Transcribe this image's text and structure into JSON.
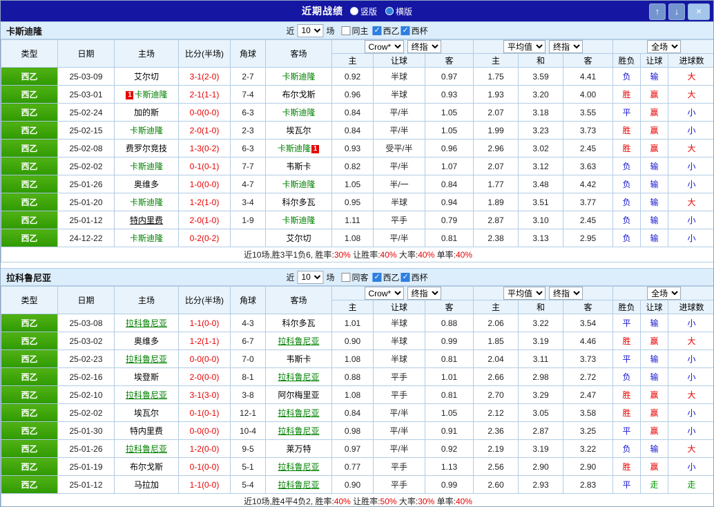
{
  "titlebar": {
    "title": "近期战绩",
    "radios": [
      {
        "label": "竖版",
        "selected": false
      },
      {
        "label": "横版",
        "selected": true
      }
    ],
    "up_icon": "↑",
    "down_icon": "↓",
    "close_icon": "×"
  },
  "labels": {
    "near": "近",
    "games": "场"
  },
  "header": {
    "cols": [
      "类型",
      "日期",
      "主场",
      "比分(半场)",
      "角球",
      "客场"
    ],
    "group1": {
      "select1": "Crow*",
      "select2": "终指",
      "subs": [
        "主",
        "让球",
        "客"
      ]
    },
    "group2": {
      "select1": "平均值",
      "select2": "终指",
      "subs": [
        "主",
        "和",
        "客"
      ]
    },
    "group3": {
      "select": "全场",
      "subs": [
        "胜负",
        "让球",
        "进球数"
      ]
    }
  },
  "sections": [
    {
      "team": "卡斯迪隆",
      "near_count": "10",
      "checks": [
        {
          "label": "同主",
          "checked": false
        },
        {
          "label": "西乙",
          "checked": true
        },
        {
          "label": "西杯",
          "checked": true
        }
      ],
      "rows": [
        {
          "lg": "西乙",
          "dt": "25-03-09",
          "h": {
            "n": "艾尔切"
          },
          "sc": "3-1(2-0)",
          "cn": "2-7",
          "a": {
            "n": "卡斯迪隆",
            "g": 1
          },
          "od": [
            "0.92",
            "半球",
            "0.97"
          ],
          "av": [
            "1.75",
            "3.59",
            "4.41"
          ],
          "rs": [
            [
              "负",
              "b"
            ],
            [
              "输",
              "b"
            ],
            [
              "大",
              "r"
            ]
          ]
        },
        {
          "lg": "西乙",
          "dt": "25-03-01",
          "h": {
            "n": "卡斯迪隆",
            "g": 1,
            "b1": "1"
          },
          "sc": "2-1(1-1)",
          "cn": "7-4",
          "a": {
            "n": "布尔戈斯"
          },
          "od": [
            "0.96",
            "半球",
            "0.93"
          ],
          "av": [
            "1.93",
            "3.20",
            "4.00"
          ],
          "rs": [
            [
              "胜",
              "r"
            ],
            [
              "赢",
              "r"
            ],
            [
              "大",
              "r"
            ]
          ]
        },
        {
          "lg": "西乙",
          "dt": "25-02-24",
          "h": {
            "n": "加的斯"
          },
          "sc": "0-0(0-0)",
          "cn": "6-3",
          "a": {
            "n": "卡斯迪隆",
            "g": 1
          },
          "od": [
            "0.84",
            "平/半",
            "1.05"
          ],
          "av": [
            "2.07",
            "3.18",
            "3.55"
          ],
          "rs": [
            [
              "平",
              "b"
            ],
            [
              "赢",
              "r"
            ],
            [
              "小",
              "b"
            ]
          ]
        },
        {
          "lg": "西乙",
          "dt": "25-02-15",
          "h": {
            "n": "卡斯迪隆",
            "g": 1
          },
          "sc": "2-0(1-0)",
          "cn": "2-3",
          "a": {
            "n": "埃瓦尔"
          },
          "od": [
            "0.84",
            "平/半",
            "1.05"
          ],
          "av": [
            "1.99",
            "3.23",
            "3.73"
          ],
          "rs": [
            [
              "胜",
              "r"
            ],
            [
              "赢",
              "r"
            ],
            [
              "小",
              "b"
            ]
          ]
        },
        {
          "lg": "西乙",
          "dt": "25-02-08",
          "h": {
            "n": "费罗尔竞技"
          },
          "sc": "1-3(0-2)",
          "cn": "6-3",
          "a": {
            "n": "卡斯迪隆",
            "g": 1,
            "b2": "1"
          },
          "od": [
            "0.93",
            "受平/半",
            "0.96"
          ],
          "av": [
            "2.96",
            "3.02",
            "2.45"
          ],
          "rs": [
            [
              "胜",
              "r"
            ],
            [
              "赢",
              "r"
            ],
            [
              "大",
              "r"
            ]
          ]
        },
        {
          "lg": "西乙",
          "dt": "25-02-02",
          "h": {
            "n": "卡斯迪隆",
            "g": 1
          },
          "sc": "0-1(0-1)",
          "cn": "7-7",
          "a": {
            "n": "韦斯卡"
          },
          "od": [
            "0.82",
            "平/半",
            "1.07"
          ],
          "av": [
            "2.07",
            "3.12",
            "3.63"
          ],
          "rs": [
            [
              "负",
              "b"
            ],
            [
              "输",
              "b"
            ],
            [
              "小",
              "b"
            ]
          ]
        },
        {
          "lg": "西乙",
          "dt": "25-01-26",
          "h": {
            "n": "奥维多"
          },
          "sc": "1-0(0-0)",
          "cn": "4-7",
          "a": {
            "n": "卡斯迪隆",
            "g": 1
          },
          "od": [
            "1.05",
            "半/一",
            "0.84"
          ],
          "av": [
            "1.77",
            "3.48",
            "4.42"
          ],
          "rs": [
            [
              "负",
              "b"
            ],
            [
              "输",
              "b"
            ],
            [
              "小",
              "b"
            ]
          ]
        },
        {
          "lg": "西乙",
          "dt": "25-01-20",
          "h": {
            "n": "卡斯迪隆",
            "g": 1
          },
          "sc": "1-2(1-0)",
          "cn": "3-4",
          "a": {
            "n": "科尔多瓦"
          },
          "od": [
            "0.95",
            "半球",
            "0.94"
          ],
          "av": [
            "1.89",
            "3.51",
            "3.77"
          ],
          "rs": [
            [
              "负",
              "b"
            ],
            [
              "输",
              "b"
            ],
            [
              "大",
              "r"
            ]
          ]
        },
        {
          "lg": "西乙",
          "dt": "25-01-12",
          "h": {
            "n": "特内里费",
            "u": 1
          },
          "sc": "2-0(1-0)",
          "cn": "1-9",
          "a": {
            "n": "卡斯迪隆",
            "g": 1
          },
          "od": [
            "1.11",
            "平手",
            "0.79"
          ],
          "av": [
            "2.87",
            "3.10",
            "2.45"
          ],
          "rs": [
            [
              "负",
              "b"
            ],
            [
              "输",
              "b"
            ],
            [
              "小",
              "b"
            ]
          ]
        },
        {
          "lg": "西乙",
          "dt": "24-12-22",
          "h": {
            "n": "卡斯迪隆",
            "g": 1
          },
          "sc": "0-2(0-2)",
          "cn": "",
          "a": {
            "n": "艾尔切"
          },
          "od": [
            "1.08",
            "平/半",
            "0.81"
          ],
          "av": [
            "2.38",
            "3.13",
            "2.95"
          ],
          "rs": [
            [
              "负",
              "b"
            ],
            [
              "输",
              "b"
            ],
            [
              "小",
              "b"
            ]
          ]
        }
      ],
      "summary": [
        {
          "t": "近10场,胜3平1负6, ",
          "c": "k"
        },
        {
          "t": "胜率:",
          "c": "k"
        },
        {
          "t": "30%",
          "c": "r"
        },
        {
          "t": " 让胜率:",
          "c": "k"
        },
        {
          "t": "40%",
          "c": "r"
        },
        {
          "t": " 大率:",
          "c": "k"
        },
        {
          "t": "40%",
          "c": "r"
        },
        {
          "t": " 单率:",
          "c": "k"
        },
        {
          "t": "40%",
          "c": "r"
        }
      ]
    },
    {
      "team": "拉科鲁尼亚",
      "near_count": "10",
      "checks": [
        {
          "label": "同客",
          "checked": false
        },
        {
          "label": "西乙",
          "checked": true
        },
        {
          "label": "西杯",
          "checked": true
        }
      ],
      "rows": [
        {
          "lg": "西乙",
          "dt": "25-03-08",
          "h": {
            "n": "拉科鲁尼亚",
            "g": 1,
            "u": 1
          },
          "sc": "1-1(0-0)",
          "cn": "4-3",
          "a": {
            "n": "科尔多瓦"
          },
          "od": [
            "1.01",
            "半球",
            "0.88"
          ],
          "av": [
            "2.06",
            "3.22",
            "3.54"
          ],
          "rs": [
            [
              "平",
              "b"
            ],
            [
              "输",
              "b"
            ],
            [
              "小",
              "b"
            ]
          ]
        },
        {
          "lg": "西乙",
          "dt": "25-03-02",
          "h": {
            "n": "奥维多"
          },
          "sc": "1-2(1-1)",
          "cn": "6-7",
          "a": {
            "n": "拉科鲁尼亚",
            "g": 1,
            "u": 1
          },
          "od": [
            "0.90",
            "半球",
            "0.99"
          ],
          "av": [
            "1.85",
            "3.19",
            "4.46"
          ],
          "rs": [
            [
              "胜",
              "r"
            ],
            [
              "赢",
              "r"
            ],
            [
              "大",
              "r"
            ]
          ]
        },
        {
          "lg": "西乙",
          "dt": "25-02-23",
          "h": {
            "n": "拉科鲁尼亚",
            "g": 1,
            "u": 1
          },
          "sc": "0-0(0-0)",
          "cn": "7-0",
          "a": {
            "n": "韦斯卡"
          },
          "od": [
            "1.08",
            "半球",
            "0.81"
          ],
          "av": [
            "2.04",
            "3.11",
            "3.73"
          ],
          "rs": [
            [
              "平",
              "b"
            ],
            [
              "输",
              "b"
            ],
            [
              "小",
              "b"
            ]
          ]
        },
        {
          "lg": "西乙",
          "dt": "25-02-16",
          "h": {
            "n": "埃登斯"
          },
          "sc": "2-0(0-0)",
          "cn": "8-1",
          "a": {
            "n": "拉科鲁尼亚",
            "g": 1,
            "u": 1
          },
          "od": [
            "0.88",
            "平手",
            "1.01"
          ],
          "av": [
            "2.66",
            "2.98",
            "2.72"
          ],
          "rs": [
            [
              "负",
              "b"
            ],
            [
              "输",
              "b"
            ],
            [
              "小",
              "b"
            ]
          ]
        },
        {
          "lg": "西乙",
          "dt": "25-02-10",
          "h": {
            "n": "拉科鲁尼亚",
            "g": 1,
            "u": 1
          },
          "sc": "3-1(3-0)",
          "cn": "3-8",
          "a": {
            "n": "阿尔梅里亚"
          },
          "od": [
            "1.08",
            "平手",
            "0.81"
          ],
          "av": [
            "2.70",
            "3.29",
            "2.47"
          ],
          "rs": [
            [
              "胜",
              "r"
            ],
            [
              "赢",
              "r"
            ],
            [
              "大",
              "r"
            ]
          ]
        },
        {
          "lg": "西乙",
          "dt": "25-02-02",
          "h": {
            "n": "埃瓦尔"
          },
          "sc": "0-1(0-1)",
          "cn": "12-1",
          "a": {
            "n": "拉科鲁尼亚",
            "g": 1,
            "u": 1
          },
          "od": [
            "0.84",
            "平/半",
            "1.05"
          ],
          "av": [
            "2.12",
            "3.05",
            "3.58"
          ],
          "rs": [
            [
              "胜",
              "r"
            ],
            [
              "赢",
              "r"
            ],
            [
              "小",
              "b"
            ]
          ]
        },
        {
          "lg": "西乙",
          "dt": "25-01-30",
          "h": {
            "n": "特内里费"
          },
          "sc": "0-0(0-0)",
          "cn": "10-4",
          "a": {
            "n": "拉科鲁尼亚",
            "g": 1,
            "u": 1
          },
          "od": [
            "0.98",
            "平/半",
            "0.91"
          ],
          "av": [
            "2.36",
            "2.87",
            "3.25"
          ],
          "rs": [
            [
              "平",
              "b"
            ],
            [
              "赢",
              "r"
            ],
            [
              "小",
              "b"
            ]
          ]
        },
        {
          "lg": "西乙",
          "dt": "25-01-26",
          "h": {
            "n": "拉科鲁尼亚",
            "g": 1,
            "u": 1
          },
          "sc": "1-2(0-0)",
          "cn": "9-5",
          "a": {
            "n": "莱万特"
          },
          "od": [
            "0.97",
            "平/半",
            "0.92"
          ],
          "av": [
            "2.19",
            "3.19",
            "3.22"
          ],
          "rs": [
            [
              "负",
              "b"
            ],
            [
              "输",
              "b"
            ],
            [
              "大",
              "r"
            ]
          ]
        },
        {
          "lg": "西乙",
          "dt": "25-01-19",
          "h": {
            "n": "布尔戈斯"
          },
          "sc": "0-1(0-0)",
          "cn": "5-1",
          "a": {
            "n": "拉科鲁尼亚",
            "g": 1,
            "u": 1
          },
          "od": [
            "0.77",
            "平手",
            "1.13"
          ],
          "av": [
            "2.56",
            "2.90",
            "2.90"
          ],
          "rs": [
            [
              "胜",
              "r"
            ],
            [
              "赢",
              "r"
            ],
            [
              "小",
              "b"
            ]
          ]
        },
        {
          "lg": "西乙",
          "dt": "25-01-12",
          "h": {
            "n": "马拉加"
          },
          "sc": "1-1(0-0)",
          "cn": "5-4",
          "a": {
            "n": "拉科鲁尼亚",
            "g": 1,
            "u": 1
          },
          "od": [
            "0.90",
            "平手",
            "0.99"
          ],
          "av": [
            "2.60",
            "2.93",
            "2.83"
          ],
          "rs": [
            [
              "平",
              "b"
            ],
            [
              "走",
              "g"
            ],
            [
              "走",
              "g"
            ]
          ]
        }
      ],
      "summary": [
        {
          "t": "近10场,胜4平4负2, ",
          "c": "k"
        },
        {
          "t": "胜率:",
          "c": "k"
        },
        {
          "t": "40%",
          "c": "r"
        },
        {
          "t": " 让胜率:",
          "c": "k"
        },
        {
          "t": "50%",
          "c": "r"
        },
        {
          "t": " 大率:",
          "c": "k"
        },
        {
          "t": "30%",
          "c": "r"
        },
        {
          "t": " 单率:",
          "c": "k"
        },
        {
          "t": "40%",
          "c": "r"
        }
      ]
    }
  ]
}
